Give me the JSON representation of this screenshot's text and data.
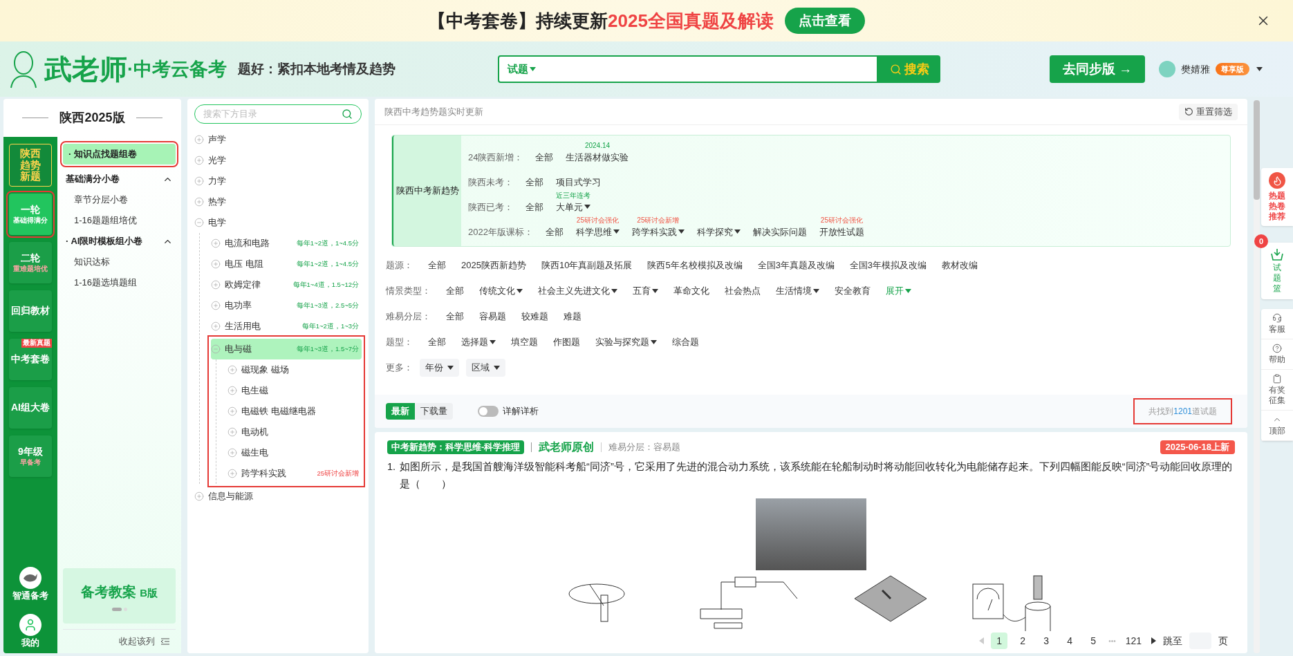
{
  "banner": {
    "prefix": "【中考套卷】持续更新",
    "highlight": "2025全国真题及解读",
    "button": "点击查看"
  },
  "header": {
    "brand": "武老师",
    "brand_sub": "·中考云备考",
    "slogan": "题好：紧扣本地考情及趋势",
    "search": {
      "scope": "试题",
      "button": "搜索"
    },
    "sync_button": "去同步版 →",
    "user": {
      "name": "樊婧雅",
      "badge": "尊享版"
    }
  },
  "left_panel": {
    "title": "陕西2025版",
    "rail": [
      {
        "kind": "trend",
        "label": "陕西趋势新题",
        "selected": false,
        "annotated": false
      },
      {
        "kind": "tile",
        "label": "一轮",
        "sub": "基础得满分",
        "selected": true,
        "annotated": true
      },
      {
        "kind": "tile",
        "label": "二轮",
        "sub": "重难题培优",
        "selected": false,
        "annotated": false
      },
      {
        "kind": "tile",
        "label": "回归教材",
        "selected": false,
        "annotated": false
      },
      {
        "kind": "tile",
        "label": "中考套卷",
        "tag": "最新真题",
        "selected": false,
        "annotated": false
      },
      {
        "kind": "tile",
        "label": "AI组大卷",
        "selected": false,
        "annotated": false
      },
      {
        "kind": "tile",
        "label": "9年级",
        "sub": "早备考",
        "selected": false,
        "annotated": false
      }
    ],
    "rail_bottom": [
      "智通备考",
      "我的"
    ],
    "menu": [
      {
        "kind": "item",
        "label": "· 知识点找题组卷",
        "selected": true,
        "annotated": true
      },
      {
        "kind": "group",
        "label": "基础满分小卷",
        "expanded": true,
        "children": [
          {
            "label": "章节分层小卷",
            "selected": false
          },
          {
            "label": "1-16题题组培优",
            "selected": false
          }
        ]
      },
      {
        "kind": "group",
        "label": "· AI限时模板组小卷",
        "expanded": true,
        "children": [
          {
            "label": "知识达标",
            "selected": false
          },
          {
            "label": "1-16题选填题组",
            "selected": false
          }
        ]
      }
    ],
    "promo": {
      "title": "备考教案",
      "tag": "B版"
    },
    "collapse": "收起该列"
  },
  "tree": {
    "placeholder": "搜索下方目录",
    "nodes": [
      {
        "label": "声学",
        "expanded": false,
        "selected": false,
        "annotated": false
      },
      {
        "label": "光学",
        "expanded": false,
        "selected": false,
        "annotated": false
      },
      {
        "label": "力学",
        "expanded": false,
        "selected": false,
        "annotated": false
      },
      {
        "label": "热学",
        "expanded": false,
        "selected": false,
        "annotated": false
      },
      {
        "label": "电学",
        "expanded": true,
        "selected": false,
        "annotated": false,
        "children": [
          {
            "label": "电流和电路",
            "note": "每年1~2道，1~4.5分",
            "note_alert": false,
            "expanded": false,
            "selected": false,
            "annotated": false
          },
          {
            "label": "电压 电阻",
            "note": "每年1~2道，1~4.5分",
            "note_alert": false,
            "expanded": false,
            "selected": false,
            "annotated": false
          },
          {
            "label": "欧姆定律",
            "note": "每年1~4道，1.5~12分",
            "note_alert": false,
            "expanded": false,
            "selected": false,
            "annotated": false
          },
          {
            "label": "电功率",
            "note": "每年1~3道，2.5~5分",
            "note_alert": false,
            "expanded": false,
            "selected": false,
            "annotated": false
          },
          {
            "label": "生活用电",
            "note": "每年1~2道，1~3分",
            "note_alert": false,
            "expanded": false,
            "selected": false,
            "annotated": false
          },
          {
            "label": "电与磁",
            "note": "每年1~3道，1.5~7分",
            "note_alert": false,
            "expanded": true,
            "selected": true,
            "annotated": true,
            "children": [
              {
                "label": "磁现象 磁场",
                "expanded": false,
                "selected": false,
                "annotated": false
              },
              {
                "label": "电生磁",
                "expanded": false,
                "selected": false,
                "annotated": false
              },
              {
                "label": "电磁铁 电磁继电器",
                "expanded": false,
                "selected": false,
                "annotated": false
              },
              {
                "label": "电动机",
                "expanded": false,
                "selected": false,
                "annotated": false
              },
              {
                "label": "磁生电",
                "expanded": false,
                "selected": false,
                "annotated": false
              },
              {
                "label": "跨学科实践",
                "note": "25研讨会新增",
                "note_alert": true,
                "expanded": false,
                "selected": false,
                "annotated": false
              }
            ]
          }
        ]
      },
      {
        "label": "信息与能源",
        "expanded": false,
        "selected": false,
        "annotated": false
      }
    ]
  },
  "main": {
    "note": "陕西中考趋势题实时更新",
    "reset": "重置筛选",
    "trend": {
      "title": "陕西中考新趋势",
      "rows": [
        {
          "label": "24陕西新增：",
          "options": [
            {
              "text": "全部",
              "dropdown": false
            },
            {
              "text": "生活器材做实验",
              "dropdown": false,
              "note": "2024.14",
              "note_alert": false
            }
          ]
        },
        {
          "label": "陕西未考：",
          "options": [
            {
              "text": "全部",
              "dropdown": false
            },
            {
              "text": "项目式学习",
              "dropdown": false
            }
          ]
        },
        {
          "label": "陕西已考：",
          "options": [
            {
              "text": "全部",
              "dropdown": false
            },
            {
              "text": "大单元",
              "dropdown": true,
              "note": "近三年连考",
              "note_alert": false
            }
          ]
        },
        {
          "label": "2022年版课标：",
          "options": [
            {
              "text": "全部",
              "dropdown": false
            },
            {
              "text": "科学思维",
              "dropdown": true,
              "note": "25研讨会强化",
              "note_alert": true
            },
            {
              "text": "跨学科实践",
              "dropdown": true,
              "note": "25研讨会新增",
              "note_alert": true
            },
            {
              "text": "科学探究",
              "dropdown": true
            },
            {
              "text": "解决实际问题",
              "dropdown": false
            },
            {
              "text": "开放性试题",
              "dropdown": false,
              "note": "25研讨会强化",
              "note_alert": true
            }
          ]
        }
      ]
    },
    "filters": [
      {
        "label": "题源：",
        "options": [
          {
            "text": "全部",
            "dropdown": false
          },
          {
            "text": "2025陕西新趋势",
            "dropdown": false
          },
          {
            "text": "陕西10年真副题及拓展",
            "dropdown": false
          },
          {
            "text": "陕西5年名校模拟及改编",
            "dropdown": false
          },
          {
            "text": "全国3年真题及改编",
            "dropdown": false
          },
          {
            "text": "全国3年模拟及改编",
            "dropdown": false
          },
          {
            "text": "教材改编",
            "dropdown": false
          }
        ]
      },
      {
        "label": "情景类型：",
        "more": "展开",
        "options": [
          {
            "text": "全部",
            "dropdown": false
          },
          {
            "text": "传统文化",
            "dropdown": true
          },
          {
            "text": "社会主义先进文化",
            "dropdown": true
          },
          {
            "text": "五育",
            "dropdown": true
          },
          {
            "text": "革命文化",
            "dropdown": false
          },
          {
            "text": "社会热点",
            "dropdown": false
          },
          {
            "text": "生活情境",
            "dropdown": true
          },
          {
            "text": "安全教育",
            "dropdown": false
          }
        ]
      },
      {
        "label": "难易分层：",
        "options": [
          {
            "text": "全部",
            "dropdown": false
          },
          {
            "text": "容易题",
            "dropdown": false
          },
          {
            "text": "较难题",
            "dropdown": false
          },
          {
            "text": "难题",
            "dropdown": false
          }
        ]
      },
      {
        "label": "题型：",
        "options": [
          {
            "text": "全部",
            "dropdown": false
          },
          {
            "text": "选择题",
            "dropdown": true
          },
          {
            "text": "填空题",
            "dropdown": false
          },
          {
            "text": "作图题",
            "dropdown": false
          },
          {
            "text": "实验与探究题",
            "dropdown": true
          },
          {
            "text": "综合题",
            "dropdown": false
          }
        ]
      }
    ],
    "more": {
      "label": "更多：",
      "selects": [
        "年份",
        "区域"
      ]
    },
    "sort": {
      "tabs": [
        {
          "label": "最新",
          "selected": true
        },
        {
          "label": "下载量",
          "selected": false
        }
      ],
      "toggle": {
        "label": "详解详析",
        "on": false
      },
      "count": {
        "prefix": "共找到",
        "number": "1201",
        "suffix": "道试题",
        "annotated": true
      }
    },
    "question": {
      "tag": "中考新趋势：科学思维-科学推理",
      "source": "武老师原创",
      "difficulty": "难易分层：容易题",
      "date": "2025-06-18上新",
      "number": "1.",
      "text": "如图所示，是我国首艘海洋级智能科考船“同济”号，它采用了先进的混合动力系统，该系统能在轮船制动时将动能回收转化为电能储存起来。下列四幅图能反映“同济”号动能回收原理的是（　　）"
    },
    "pagination": {
      "pages": [
        {
          "label": "1",
          "selected": true
        },
        {
          "label": "2",
          "selected": false
        },
        {
          "label": "3",
          "selected": false
        },
        {
          "label": "4",
          "selected": false
        },
        {
          "label": "5",
          "selected": false
        }
      ],
      "ellipsis": "•••",
      "last": "121",
      "jump": "跳至",
      "suffix": "页"
    }
  },
  "side": {
    "hot": "热题热卷推荐",
    "basket": {
      "label": "试题篮",
      "count": "0"
    },
    "tools": [
      "客服",
      "帮助",
      "有奖征集",
      "顶部"
    ]
  }
}
